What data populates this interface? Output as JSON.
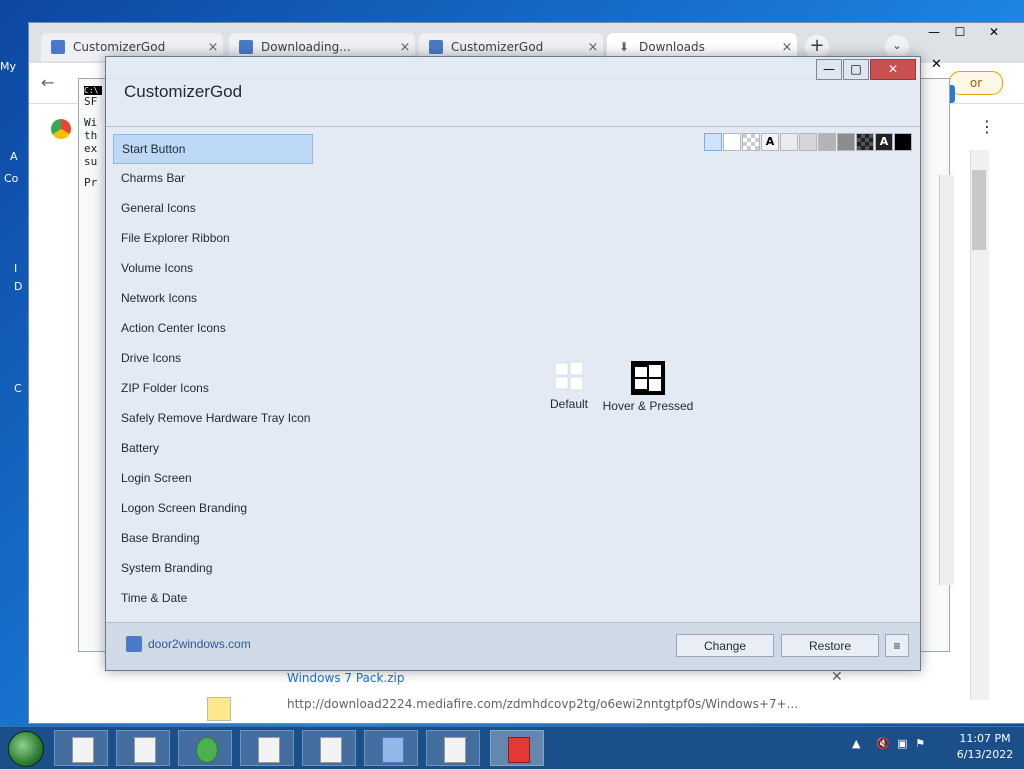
{
  "desktop": {
    "icons": [
      "My",
      "A",
      "Co",
      "I",
      "D",
      "C"
    ]
  },
  "browser": {
    "tabs": [
      {
        "label": "CustomizerGod",
        "close": "×"
      },
      {
        "label": "Downloading...",
        "close": "×"
      },
      {
        "label": "CustomizerGod",
        "close": "×"
      },
      {
        "label": "Downloads",
        "close": "×"
      }
    ],
    "new_tab": "+",
    "tab_menu": "⌄",
    "controls": {
      "minimize": "—",
      "maximize": "☐",
      "close": "✕"
    },
    "overlay_close": "✕",
    "error_badge": "or",
    "download": {
      "name": "Windows 7 Pack.zip",
      "url": "http://download2224.mediafire.com/zdmhdcovp2tg/o6ewi2nntgtpf0s/Windows+7+...",
      "close": "✕"
    }
  },
  "console": {
    "lines": [
      "C:\\",
      "SF",
      "Wi",
      "th",
      "ex",
      "su",
      "Pr"
    ]
  },
  "app": {
    "title": "CustomizerGod",
    "window_controls": {
      "minimize": "—",
      "maximize": "□",
      "close": "✕"
    },
    "menu": [
      "Start Button",
      "Charms Bar",
      "General Icons",
      "File Explorer Ribbon",
      "Volume Icons",
      "Network Icons",
      "Action Center Icons",
      "Drive Icons",
      "ZIP Folder Icons",
      "Safely Remove Hardware Tray Icon",
      "Battery",
      "Login Screen",
      "Logon Screen Branding",
      "Base Branding",
      "System Branding",
      "Time & Date"
    ],
    "selected_index": 0,
    "swatch_labels": {
      "light_a": "A",
      "dark_a": "A"
    },
    "preview": {
      "default_label": "Default",
      "hover_label": "Hover & Pressed"
    },
    "footer": {
      "site": "door2windows.com",
      "change": "Change",
      "restore": "Restore",
      "menu": "≡"
    }
  },
  "taskbar": {
    "clock_time": "11:07 PM",
    "clock_date": "6/13/2022"
  }
}
